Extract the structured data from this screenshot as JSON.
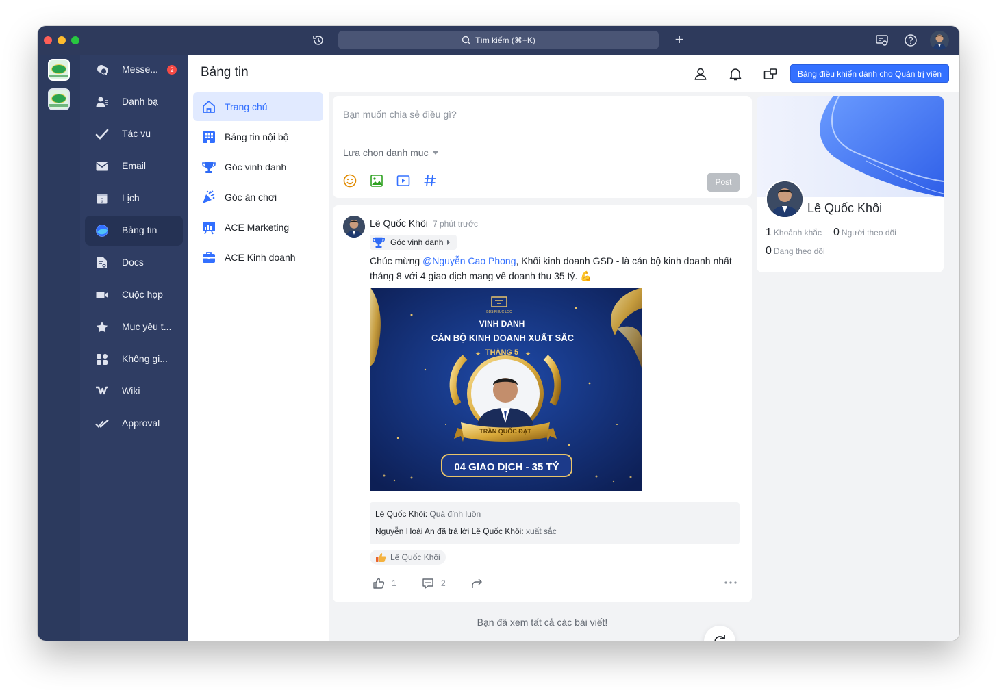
{
  "titlebar": {
    "search_label": "Tìm kiếm (⌘+K)",
    "icons": [
      "history-icon",
      "search-icon",
      "plus-icon",
      "screen-share-icon",
      "help-icon",
      "avatar"
    ]
  },
  "nav": {
    "items": [
      {
        "label": "Messe...",
        "icon": "chat-icon",
        "badge": "2"
      },
      {
        "label": "Danh bạ",
        "icon": "contacts-icon"
      },
      {
        "label": "Tác vụ",
        "icon": "tasks-icon"
      },
      {
        "label": "Email",
        "icon": "mail-icon"
      },
      {
        "label": "Lịch",
        "icon": "calendar-icon",
        "calendar_day": "9"
      },
      {
        "label": "Bảng tin",
        "icon": "moments-icon",
        "active": true
      },
      {
        "label": "Docs",
        "icon": "docs-icon"
      },
      {
        "label": "Cuộc họp",
        "icon": "video-icon"
      },
      {
        "label": "Mục yêu t...",
        "icon": "star-icon"
      },
      {
        "label": "Không gi...",
        "icon": "workplace-icon"
      },
      {
        "label": "Wiki",
        "icon": "wiki-icon"
      },
      {
        "label": "Approval",
        "icon": "approval-icon"
      }
    ]
  },
  "header": {
    "title": "Bảng tin",
    "admin_button": "Bảng điều khiển dành cho Quản trị viên"
  },
  "feed_menu": {
    "items": [
      {
        "label": "Trang chủ",
        "icon": "home-icon",
        "active": true
      },
      {
        "label": "Bảng tin nội bộ",
        "icon": "building-icon"
      },
      {
        "label": "Góc vinh danh",
        "icon": "trophy-icon"
      },
      {
        "label": "Góc ăn chơi",
        "icon": "party-icon"
      },
      {
        "label": "ACE Marketing",
        "icon": "chart-icon"
      },
      {
        "label": "ACE Kinh doanh",
        "icon": "briefcase-icon"
      }
    ]
  },
  "composer": {
    "placeholder": "Bạn muốn chia sẻ điều gì?",
    "category_select": "Lựa chọn danh mục",
    "post_button": "Post"
  },
  "post": {
    "author": "Lê Quốc Khôi",
    "time": "7 phút trước",
    "category": "Góc vinh danh",
    "text_before": "Chúc mừng ",
    "mention": "@Nguyễn Cao Phong",
    "text_after": ", Khối kinh doanh GSD - là cán bộ kinh doanh nhất tháng 8 với 4 giao dịch mang về doanh thu 35 tỷ. 💪",
    "image": {
      "line1": "VINH DANH",
      "line2": "CÁN BỘ KINH DOANH XUẤT SẮC",
      "line3": "THÁNG 5",
      "logo_text": "BDS PHUC LOC",
      "name_ribbon": "TRẦN QUỐC ĐẠT",
      "banner": "04 GIAO DỊCH - 35 TỶ"
    },
    "comments": [
      {
        "who": "Lê Quốc Khôi:",
        "text": "Quá đỉnh luôn"
      },
      {
        "who": "Nguyễn Hoài An đã trả lời Lê Quốc Khôi:",
        "text": "xuất sắc"
      }
    ],
    "reaction_user": "Lê Quốc Khôi",
    "likes": "1",
    "comment_count": "2"
  },
  "feed_end": "Bạn đã xem tất cả các bài viết!",
  "profile": {
    "name": "Lê Quốc Khôi",
    "moments_count": "1",
    "moments_label": "Khoảnh khắc",
    "followers_count": "0",
    "followers_label": "Người theo dõi",
    "following_count": "0",
    "following_label": "Đang theo dõi"
  },
  "colors": {
    "accent": "#3370ff",
    "nav_bg": "#2f3d63",
    "badge": "#f54a45"
  }
}
